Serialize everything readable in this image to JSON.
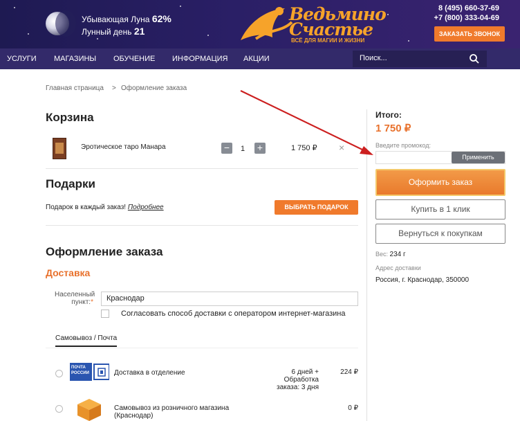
{
  "header": {
    "moon_phase_label": "Убывающая Луна",
    "moon_phase_value": "62%",
    "moon_day_label": "Лунный день",
    "moon_day_value": "21",
    "logo_line1": "Ведьмино",
    "logo_line2": "Счастье",
    "logo_tagline": "ВСЁ ДЛЯ МАГИИ И ЖИЗНИ",
    "phone1": "8 (495) 660-37-69",
    "phone2": "+7 (800) 333-04-69",
    "callback_label": "ЗАКАЗАТЬ ЗВОНОК"
  },
  "nav": {
    "items": [
      "УСЛУГИ",
      "МАГАЗИНЫ",
      "ОБУЧЕНИЕ",
      "ИНФОРМАЦИЯ",
      "АКЦИИ"
    ],
    "search_placeholder": "Поиск..."
  },
  "breadcrumb": {
    "home": "Главная страница",
    "separator": ">",
    "current": "Оформление заказа"
  },
  "cart": {
    "title": "Корзина",
    "item_name": "Эротическое таро Манара",
    "qty_minus": "−",
    "qty": "1",
    "qty_plus": "+",
    "price": "1 750 ₽",
    "remove": "×"
  },
  "gifts": {
    "title": "Подарки",
    "text": "Подарок в каждый заказ!",
    "more_link": "Подробнее",
    "button": "ВЫБРАТЬ ПОДАРОК"
  },
  "checkout": {
    "title": "Оформление заказа",
    "delivery_title": "Доставка",
    "city_label_1": "Населенный",
    "city_label_2": "пункт:",
    "required_mark": "*",
    "city_value": "Краснодар",
    "operator_text": "Согласовать способ доставки с оператором интернет-магазина",
    "tab": "Самовывоз / Почта",
    "options": [
      {
        "logo_text_1": "ПОЧТА",
        "logo_text_2": "РОССИИ",
        "name": "Доставка в отделение",
        "term_1": "6 дней +",
        "term_2": "Обработка",
        "term_3": "заказа: 3 дня",
        "price": "224 ₽"
      },
      {
        "name_1": "Самовывоз из розничного магазина",
        "name_2": "(Краснодар)",
        "price": "0 ₽"
      }
    ]
  },
  "summary": {
    "total_label": "Итого:",
    "total_value": "1 750 ₽",
    "promo_label": "Введите промокод:",
    "apply_label": "Применить",
    "order_label": "Оформить заказ",
    "one_click_label": "Купить в 1 клик",
    "back_label": "Вернуться к покупкам",
    "weight_label": "Вес:",
    "weight_value": "234 г",
    "address_label": "Адрес доставки",
    "address_value": "Россия, г. Краснодар, 350000"
  },
  "colors": {
    "header_bg": "#2a1f66",
    "nav_bg": "#332a6a",
    "accent": "#e8712c",
    "arrow": "#cc1f1f"
  }
}
